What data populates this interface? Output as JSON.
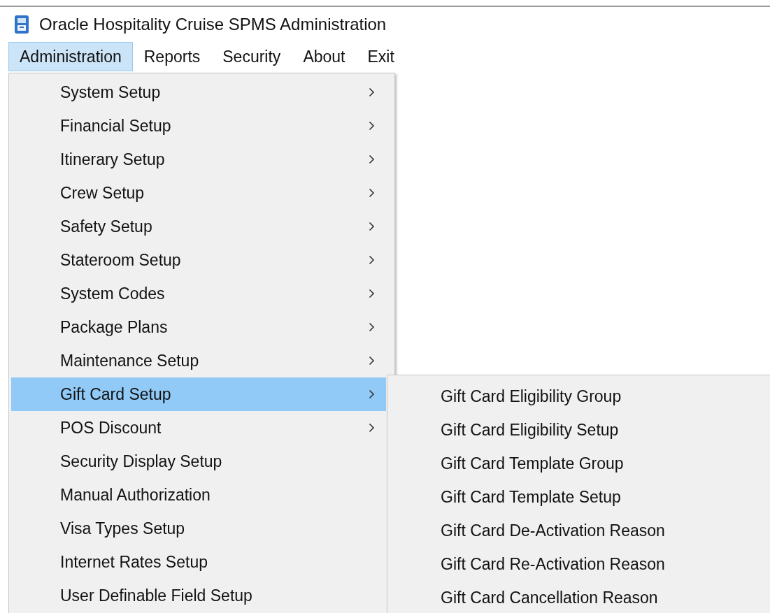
{
  "window": {
    "title": "Oracle Hospitality Cruise SPMS Administration"
  },
  "menu_bar": [
    {
      "label": "Administration",
      "selected": true
    },
    {
      "label": "Reports",
      "selected": false
    },
    {
      "label": "Security",
      "selected": false
    },
    {
      "label": "About",
      "selected": false
    },
    {
      "label": "Exit",
      "selected": false
    }
  ],
  "menu": {
    "items": [
      {
        "label": "System Setup",
        "has_submenu": true,
        "selected": false
      },
      {
        "label": "Financial Setup",
        "has_submenu": true,
        "selected": false
      },
      {
        "label": "Itinerary Setup",
        "has_submenu": true,
        "selected": false
      },
      {
        "label": "Crew Setup",
        "has_submenu": true,
        "selected": false
      },
      {
        "label": "Safety Setup",
        "has_submenu": true,
        "selected": false
      },
      {
        "label": "Stateroom Setup",
        "has_submenu": true,
        "selected": false
      },
      {
        "label": "System Codes",
        "has_submenu": true,
        "selected": false
      },
      {
        "label": "Package Plans",
        "has_submenu": true,
        "selected": false
      },
      {
        "label": "Maintenance Setup",
        "has_submenu": true,
        "selected": false
      },
      {
        "label": "Gift Card Setup",
        "has_submenu": true,
        "selected": true
      },
      {
        "label": "POS Discount",
        "has_submenu": true,
        "selected": false
      },
      {
        "label": "Security Display Setup",
        "has_submenu": false,
        "selected": false
      },
      {
        "label": "Manual Authorization",
        "has_submenu": false,
        "selected": false
      },
      {
        "label": "Visa Types Setup",
        "has_submenu": false,
        "selected": false
      },
      {
        "label": "Internet Rates Setup",
        "has_submenu": false,
        "selected": false
      },
      {
        "label": "User Definable Field Setup",
        "has_submenu": false,
        "selected": false
      }
    ]
  },
  "submenu": {
    "items": [
      {
        "label": "Gift Card Eligibility Group"
      },
      {
        "label": "Gift Card Eligibility Setup"
      },
      {
        "label": "Gift Card Template Group"
      },
      {
        "label": "Gift Card Template Setup"
      },
      {
        "label": "Gift Card De-Activation Reason"
      },
      {
        "label": "Gift Card Re-Activation Reason"
      },
      {
        "label": "Gift Card Cancellation Reason"
      }
    ]
  }
}
